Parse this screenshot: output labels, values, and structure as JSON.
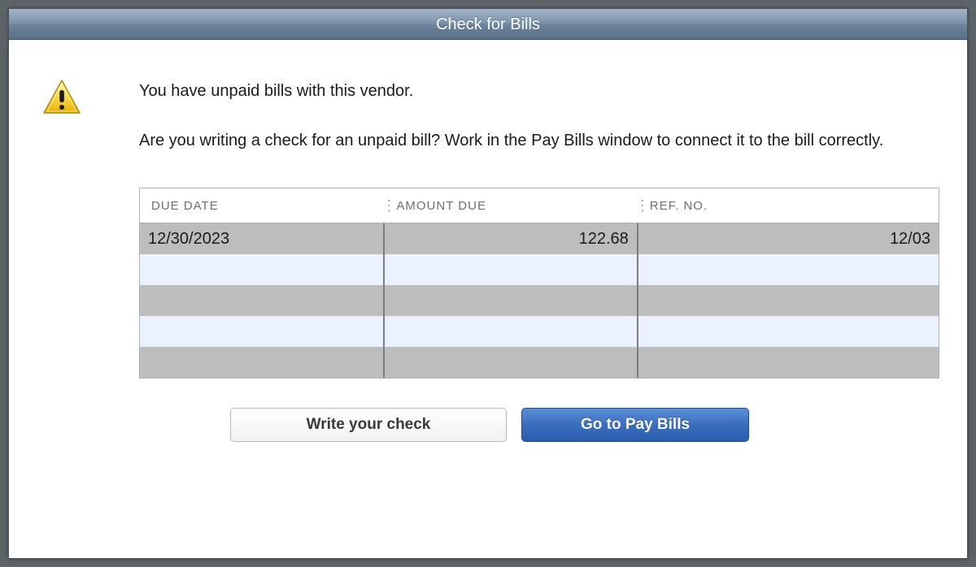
{
  "dialog": {
    "title": "Check for Bills"
  },
  "message": {
    "line1": "You have unpaid bills with this vendor.",
    "line2": "Are you writing a check for an unpaid bill? Work in the Pay Bills window to connect it to the bill correctly."
  },
  "table": {
    "headers": {
      "due_date": "DUE DATE",
      "amount_due": "AMOUNT DUE",
      "ref_no": "REF. NO."
    },
    "rows": [
      {
        "due_date": "12/30/2023",
        "amount_due": "122.68",
        "ref_no": "12/03"
      },
      {
        "due_date": "",
        "amount_due": "",
        "ref_no": ""
      },
      {
        "due_date": "",
        "amount_due": "",
        "ref_no": ""
      },
      {
        "due_date": "",
        "amount_due": "",
        "ref_no": ""
      },
      {
        "due_date": "",
        "amount_due": "",
        "ref_no": ""
      }
    ]
  },
  "buttons": {
    "write_check": "Write your check",
    "go_pay_bills": "Go to Pay Bills"
  }
}
